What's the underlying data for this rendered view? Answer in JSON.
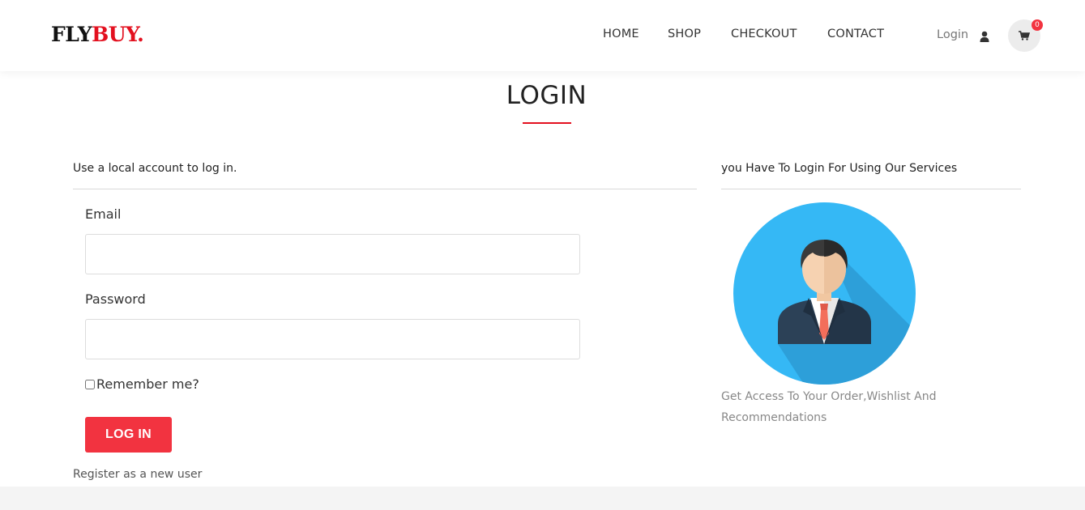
{
  "brand": {
    "part1": "FLY",
    "part2": "BUY",
    "dot": "."
  },
  "nav": {
    "items": [
      {
        "label": "HOME"
      },
      {
        "label": "SHOP"
      },
      {
        "label": "CHECKOUT"
      },
      {
        "label": "CONTACT"
      }
    ],
    "login_label": "Login",
    "user_icon": "user-icon",
    "cart_icon": "cart-icon",
    "cart_count": "0"
  },
  "page": {
    "title": "LOGIN"
  },
  "login_form": {
    "heading": "Use a local account to log in.",
    "email_label": "Email",
    "email_value": "",
    "password_label": "Password",
    "password_value": "",
    "remember_label": "Remember me?",
    "remember_checked": false,
    "submit_label": "LOG IN",
    "register_link": "Register as a new user"
  },
  "side_panel": {
    "heading": "you Have To Login For Using Our Services",
    "description": "Get Access To Your Order,Wishlist And Recommendations"
  },
  "colors": {
    "accent": "#f23340",
    "brand_red": "#e3101f",
    "avatar_bg": "#35b8f5"
  }
}
